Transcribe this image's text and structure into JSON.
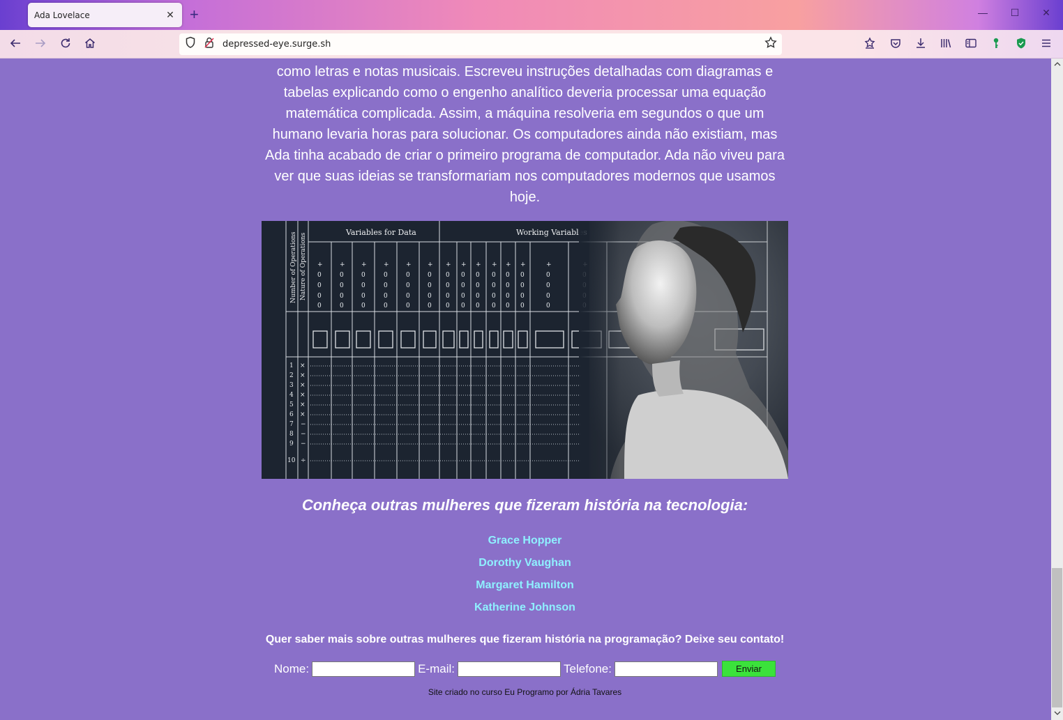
{
  "browser": {
    "tab_title": "Ada Lovelace",
    "tab_close": "✕",
    "new_tab": "+",
    "url": "depressed-eye.surge.sh",
    "window": {
      "minimize": "—",
      "maximize": "☐",
      "close": "✕"
    }
  },
  "main": {
    "paragraph": "como letras e notas musicais. Escreveu instruções detalhadas com diagramas e tabelas explicando como o engenho analítico deveria processar uma equação matemática complicada. Assim, a máquina resolveria em segundos o que um humano levaria horas para solucionar. Os computadores ainda não existiam, mas Ada tinha acabado de criar o primeiro programa de computador. Ada não viveu para ver que suas ideias se transformariam nos computadores modernos que usamos hoje.",
    "image": {
      "header_left": "Variables for Data",
      "header_right": "Working Variables",
      "side_label_1": "Number of Operations",
      "side_label_2": "Nature of Operations"
    },
    "subtitle": "Conheça outras mulheres que fizeram história na tecnologia:",
    "links": [
      "Grace Hopper",
      "Dorothy Vaughan",
      "Margaret Hamilton",
      "Katherine Johnson"
    ],
    "cta": "Quer saber mais sobre outras mulheres que fizeram história na programação? Deixe seu contato!",
    "form": {
      "name_label": "Nome:",
      "email_label": "E-mail:",
      "phone_label": "Telefone:",
      "submit_label": "Enviar"
    },
    "footer": "Site criado no curso Eu Programo por Ádria Tavares"
  }
}
